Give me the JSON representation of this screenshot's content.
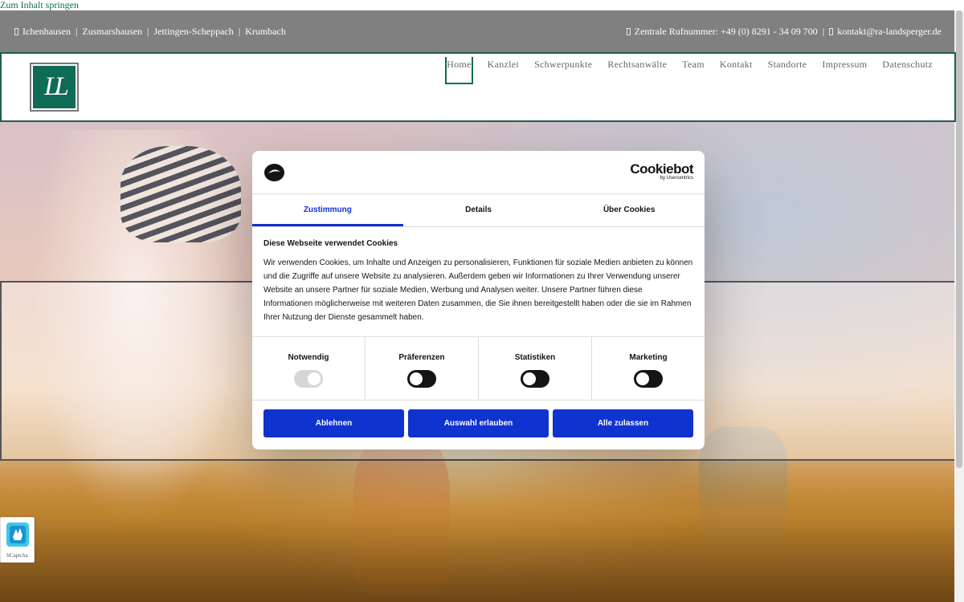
{
  "skip_link": "Zum Inhalt springen",
  "topbar": {
    "locations": [
      "Ichenhausen",
      "Zusmarshausen",
      "Jettingen-Scheppach",
      "Krumbach"
    ],
    "phone": "Zentrale Rufnummer: +49 (0) 8291 - 34 09 700",
    "email": "kontakt@ra-landsperger.de"
  },
  "logo": {
    "text": "LL"
  },
  "nav": {
    "items": [
      "Home",
      "Kanzlei",
      "Schwerpunkte",
      "Rechtsanwälte",
      "Team",
      "Kontakt",
      "Standorte",
      "Impressum",
      "Datenschutz"
    ],
    "active": "Home"
  },
  "hcaptcha": {
    "label": "hCaptcha"
  },
  "cookie_dialog": {
    "brand": "Cookiebot",
    "brand_sub": "by Usercentrics",
    "tabs": [
      "Zustimmung",
      "Details",
      "Über Cookies"
    ],
    "active_tab": "Zustimmung",
    "heading": "Diese Webseite verwendet Cookies",
    "text": "Wir verwenden Cookies, um Inhalte und Anzeigen zu personalisieren, Funktionen für soziale Medien anbieten zu können und die Zugriffe auf unsere Website zu analysieren. Außerdem geben wir Informationen zu Ihrer Verwendung unserer Website an unsere Partner für soziale Medien, Werbung und Analysen weiter. Unsere Partner führen diese Informationen möglicherweise mit weiteren Daten zusammen, die Sie ihnen bereitgestellt haben oder die sie im Rahmen Ihrer Nutzung der Dienste gesammelt haben.",
    "categories": [
      {
        "label": "Notwendig",
        "state": "on-disabled"
      },
      {
        "label": "Präferenzen",
        "state": "off"
      },
      {
        "label": "Statistiken",
        "state": "off"
      },
      {
        "label": "Marketing",
        "state": "off"
      }
    ],
    "buttons": [
      "Ablehnen",
      "Auswahl erlauben",
      "Alle zulassen"
    ]
  },
  "colors": {
    "accent": "#1032cf",
    "brand_green": "#0e6b55",
    "topbar": "#808080"
  }
}
